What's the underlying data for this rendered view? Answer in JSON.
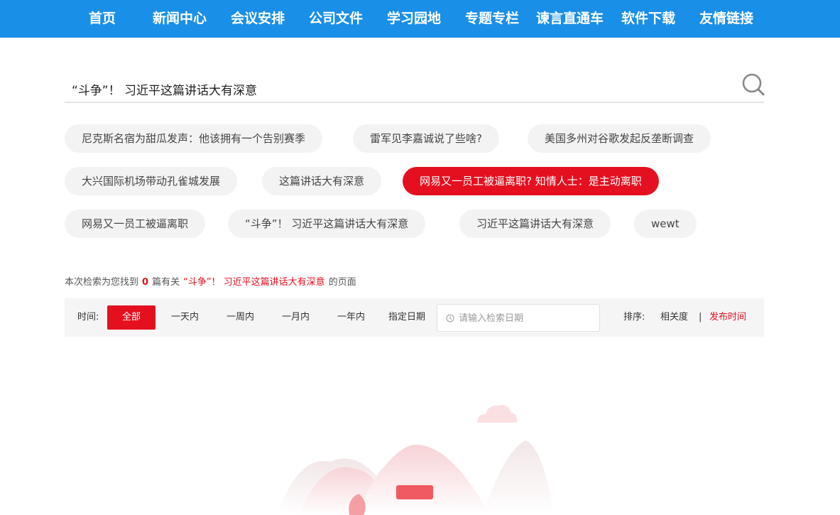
{
  "nav": {
    "items": [
      "首页",
      "新闻中心",
      "会议安排",
      "公司文件",
      "学习园地",
      "专题专栏",
      "谏言直通车",
      "软件下载",
      "友情链接"
    ]
  },
  "search": {
    "value": "“斗争”！ 习近平这篇讲话大有深意",
    "placeholder": ""
  },
  "tags": [
    "尼克斯名宿为甜瓜发声：他该拥有一个告别赛季",
    "雷军见李嘉诚说了些啥?",
    "美国多州对谷歌发起反垄断调查",
    "大兴国际机场带动孔雀城发展",
    "这篇讲话大有深意",
    "网易又一员工被逼离职? 知情人士：是主动离职",
    "网易又一员工被逼离职",
    "“斗争”！ 习近平这篇讲话大有深意",
    "习近平这篇讲话大有深意",
    "wewt"
  ],
  "active_tag_index": 5,
  "summary": {
    "prefix": "本次检索为您找到",
    "count": "0",
    "middle": "篇有关",
    "keyword": "“斗争”！ 习近平这篇讲话大有深意",
    "suffix": "的页面"
  },
  "filter": {
    "time_label": "时间:",
    "options": [
      "全部",
      "一天内",
      "一周内",
      "一月内",
      "一年内"
    ],
    "active_option": 0,
    "custom_date_label": "指定日期",
    "date_placeholder": "请输入检索日期",
    "sort_label": "排序:",
    "sort_options": [
      "相关度",
      "发布时间"
    ],
    "sort_separator": "|",
    "active_sort": 1
  },
  "colors": {
    "nav_bg": "#1a8fe8",
    "accent_red": "#e4101f",
    "tag_bg": "#f3f3f3",
    "filter_bg": "#f5f5f5"
  }
}
